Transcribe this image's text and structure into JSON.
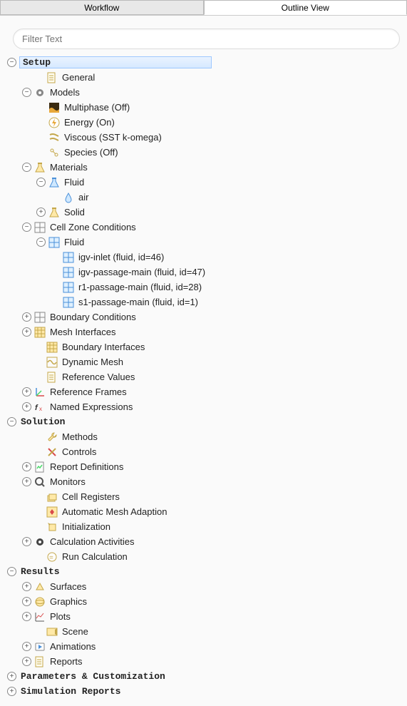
{
  "tabs": {
    "workflow": "Workflow",
    "outline": "Outline View"
  },
  "filter": {
    "placeholder": "Filter Text"
  },
  "sections": {
    "setup": "Setup",
    "solution": "Solution",
    "results": "Results",
    "params": "Parameters & Customization",
    "simrep": "Simulation Reports"
  },
  "setup": {
    "general": "General",
    "models": {
      "label": "Models",
      "multiphase": "Multiphase (Off)",
      "energy": "Energy (On)",
      "viscous": "Viscous (SST k-omega)",
      "species": "Species (Off)"
    },
    "materials": {
      "label": "Materials",
      "fluid": "Fluid",
      "air": "air",
      "solid": "Solid"
    },
    "czc": {
      "label": "Cell Zone Conditions",
      "fluid": "Fluid",
      "z1": "igv-inlet (fluid, id=46)",
      "z2": "igv-passage-main (fluid, id=47)",
      "z3": "r1-passage-main (fluid, id=28)",
      "z4": "s1-passage-main (fluid, id=1)"
    },
    "bc": "Boundary Conditions",
    "meshif": "Mesh Interfaces",
    "boundif": "Boundary Interfaces",
    "dynmesh": "Dynamic Mesh",
    "refval": "Reference Values",
    "refframes": "Reference Frames",
    "namedexpr": "Named Expressions"
  },
  "solution": {
    "methods": "Methods",
    "controls": "Controls",
    "reportdef": "Report Definitions",
    "monitors": "Monitors",
    "cellreg": "Cell Registers",
    "automesh": "Automatic Mesh Adaption",
    "init": "Initialization",
    "calcact": "Calculation Activities",
    "runcalc": "Run Calculation"
  },
  "results": {
    "surfaces": "Surfaces",
    "graphics": "Graphics",
    "plots": "Plots",
    "scene": "Scene",
    "animations": "Animations",
    "reports": "Reports"
  }
}
